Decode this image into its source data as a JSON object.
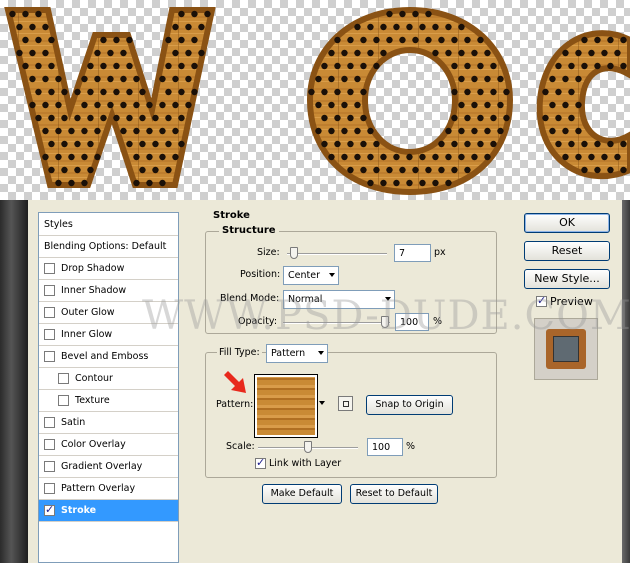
{
  "watermark": "WWW.PSD-DUDE.COM",
  "styles_panel": {
    "header": "Styles",
    "items": [
      {
        "label": "Blending Options: Default",
        "checkbox": false,
        "checked": false,
        "indent": 0,
        "selected": false
      },
      {
        "label": "Drop Shadow",
        "checkbox": true,
        "checked": false,
        "indent": 0,
        "selected": false
      },
      {
        "label": "Inner Shadow",
        "checkbox": true,
        "checked": false,
        "indent": 0,
        "selected": false
      },
      {
        "label": "Outer Glow",
        "checkbox": true,
        "checked": false,
        "indent": 0,
        "selected": false
      },
      {
        "label": "Inner Glow",
        "checkbox": true,
        "checked": false,
        "indent": 0,
        "selected": false
      },
      {
        "label": "Bevel and Emboss",
        "checkbox": true,
        "checked": false,
        "indent": 0,
        "selected": false
      },
      {
        "label": "Contour",
        "checkbox": true,
        "checked": false,
        "indent": 1,
        "selected": false
      },
      {
        "label": "Texture",
        "checkbox": true,
        "checked": false,
        "indent": 1,
        "selected": false
      },
      {
        "label": "Satin",
        "checkbox": true,
        "checked": false,
        "indent": 0,
        "selected": false
      },
      {
        "label": "Color Overlay",
        "checkbox": true,
        "checked": false,
        "indent": 0,
        "selected": false
      },
      {
        "label": "Gradient Overlay",
        "checkbox": true,
        "checked": false,
        "indent": 0,
        "selected": false
      },
      {
        "label": "Pattern Overlay",
        "checkbox": true,
        "checked": false,
        "indent": 0,
        "selected": false
      },
      {
        "label": "Stroke",
        "checkbox": true,
        "checked": true,
        "indent": 0,
        "selected": true
      }
    ]
  },
  "stroke": {
    "title": "Stroke",
    "structure": {
      "title": "Structure",
      "size_label": "Size:",
      "size_value": "7",
      "size_unit": "px",
      "position_label": "Position:",
      "position_value": "Center",
      "blend_mode_label": "Blend Mode:",
      "blend_mode_value": "Normal",
      "opacity_label": "Opacity:",
      "opacity_value": "100",
      "opacity_unit": "%"
    },
    "fill": {
      "fill_type_label": "Fill Type:",
      "fill_type_value": "Pattern",
      "pattern_label": "Pattern:",
      "snap_button": "Snap to Origin",
      "scale_label": "Scale:",
      "scale_value": "100",
      "scale_unit": "%",
      "link_label": "Link with Layer",
      "link_checked": true
    },
    "make_default": "Make Default",
    "reset_default": "Reset to Default"
  },
  "buttons": {
    "ok": "OK",
    "reset": "Reset",
    "new_style": "New Style...",
    "preview_label": "Preview",
    "preview_checked": true
  },
  "colors": {
    "wood": "#c98a35",
    "wood_dark": "#8a5214",
    "selection": "#3399ff",
    "arrow": "#e8291c"
  }
}
